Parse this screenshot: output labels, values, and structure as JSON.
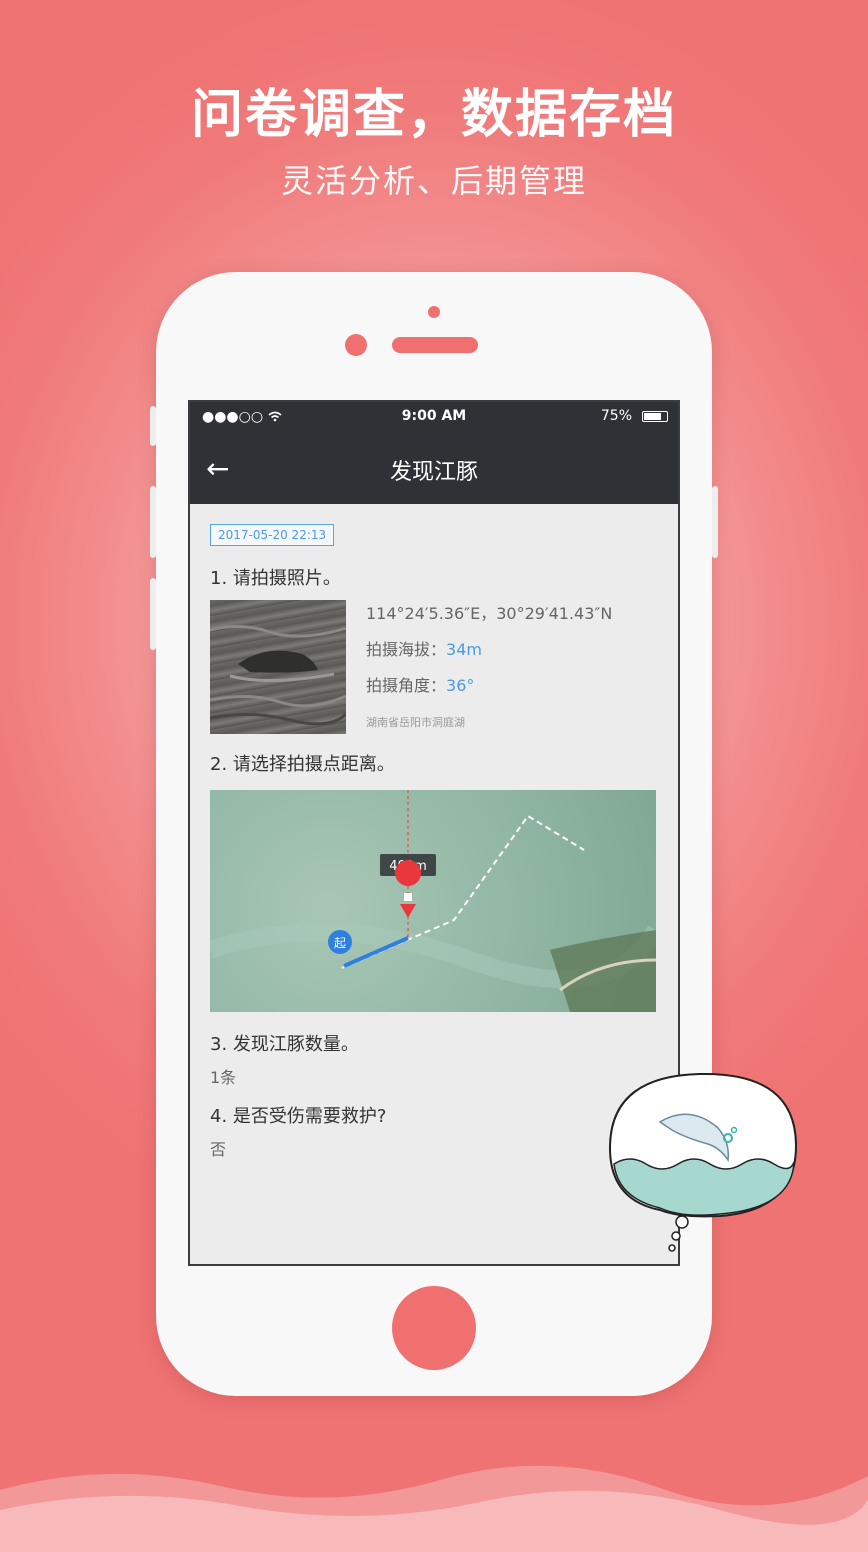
{
  "promo": {
    "headline": "问卷调查，数据存档",
    "subline": "灵活分析、后期管理"
  },
  "status_bar": {
    "signal": "●●●○○",
    "time": "9:00 AM",
    "battery": "75%",
    "battery_level": 0.75
  },
  "nav": {
    "back_glyph": "←",
    "title": "发现江豚"
  },
  "record": {
    "datetime": "2017-05-20  22:13",
    "q1": {
      "label": "1. 请拍摄照片。",
      "coords": "114°24′5.36″E，30°29′41.43″N",
      "altitude_label": "拍摄海拔：",
      "altitude_value": "34m",
      "angle_label": "拍摄角度：",
      "angle_value": "36°",
      "location": "湖南省岳阳市洞庭湖"
    },
    "q2": {
      "label": "2. 请选择拍摄点距离。",
      "distance_tag": "400m",
      "start_marker": "起"
    },
    "q3": {
      "label": "3. 发现江豚数量。",
      "answer": "1条"
    },
    "q4": {
      "label": "4. 是否受伤需要救护?",
      "answer": "否"
    }
  },
  "colors": {
    "background": "#f07a7a",
    "accent_blue": "#4a9be0",
    "navbar": "#2e3135",
    "marker_red": "#e8383d"
  }
}
